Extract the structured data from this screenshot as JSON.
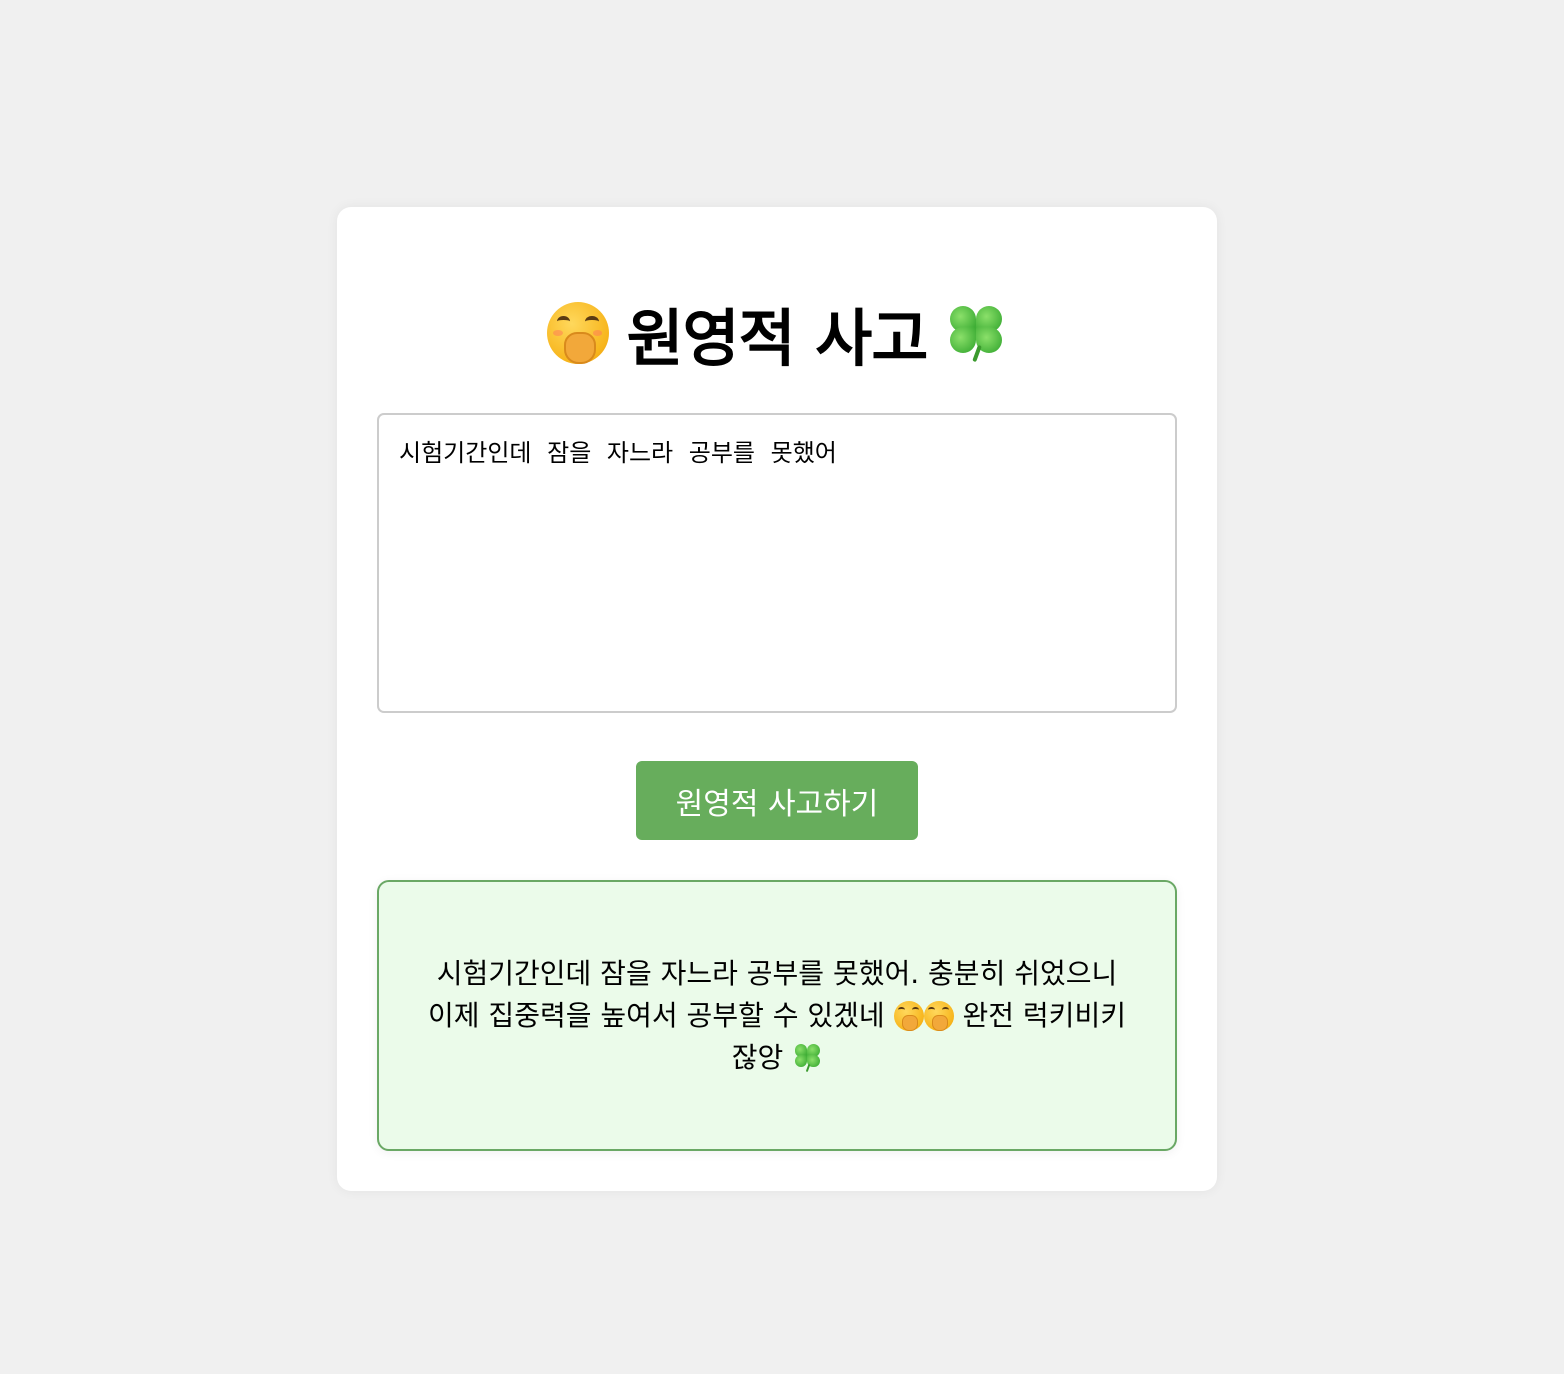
{
  "header": {
    "title": "원영적 사고",
    "left_icon": "hand-over-mouth-face-icon",
    "right_icon": "four-leaf-clover-icon"
  },
  "input": {
    "value": "시험기간인데 잠을 자느라 공부를 못했어",
    "placeholder": ""
  },
  "button": {
    "label": "원영적 사고하기"
  },
  "result": {
    "text_part1": "시험기간인데 잠을 자느라 공부를 못했어. 충분히 쉬었으니 이제 집중력을 높여서 공부할 수 있겠네",
    "text_part2": "완전 럭키비키잖앙",
    "icons": [
      "hand-over-mouth-face-icon",
      "hand-over-mouth-face-icon",
      "four-leaf-clover-icon"
    ]
  },
  "colors": {
    "page_bg": "#f0f0f0",
    "card_bg": "#ffffff",
    "button_bg": "#67ad5c",
    "result_bg": "#ebfbea",
    "result_border": "#6aa865"
  }
}
